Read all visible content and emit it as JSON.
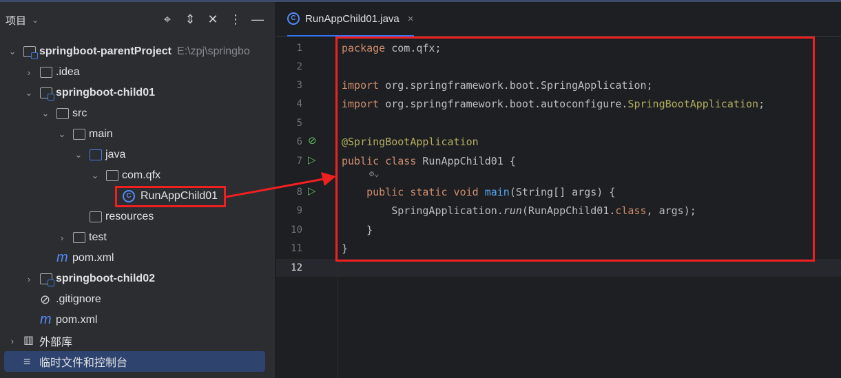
{
  "panel": {
    "title": "项目",
    "tools": [
      "locate-icon",
      "expand-icon",
      "collapse-icon",
      "more-icon",
      "minimize-icon"
    ]
  },
  "tree": [
    {
      "level": 0,
      "open": true,
      "icon": "module",
      "label": "springboot-parentProject",
      "bold": true,
      "path": "E:\\zpj\\springbo"
    },
    {
      "level": 1,
      "open": false,
      "icon": "folder",
      "label": ".idea"
    },
    {
      "level": 1,
      "open": true,
      "icon": "module",
      "label": "springboot-child01",
      "bold": true
    },
    {
      "level": 2,
      "open": true,
      "icon": "folder",
      "label": "src"
    },
    {
      "level": 3,
      "open": true,
      "icon": "folder",
      "label": "main"
    },
    {
      "level": 4,
      "open": true,
      "icon": "source",
      "label": "java"
    },
    {
      "level": 5,
      "open": true,
      "icon": "package",
      "label": "com.qfx"
    },
    {
      "level": 6,
      "icon": "class",
      "label": "RunAppChild01"
    },
    {
      "level": 4,
      "icon": "resources",
      "label": "resources"
    },
    {
      "level": 3,
      "open": false,
      "icon": "folder",
      "label": "test"
    },
    {
      "level": 2,
      "icon": "maven",
      "label": "pom.xml"
    },
    {
      "level": 1,
      "open": false,
      "icon": "module",
      "label": "springboot-child02",
      "bold": true
    },
    {
      "level": 1,
      "icon": "ignore",
      "label": ".gitignore"
    },
    {
      "level": 1,
      "icon": "maven",
      "label": "pom.xml"
    },
    {
      "level": 0,
      "open": false,
      "icon": "library",
      "label": "外部库"
    },
    {
      "level": 0,
      "icon": "scratch",
      "label": "临时文件和控制台",
      "selected": true
    }
  ],
  "tab": {
    "label": "RunAppChild01.java",
    "close": "×"
  },
  "colors": {
    "keyword": "#cf8e6d",
    "annotation": "#b3ae60",
    "method": "#56a8f5",
    "text": "#bcbec4",
    "highlight": "#f02020"
  },
  "code": [
    [
      [
        "package ",
        "kw"
      ],
      [
        "com.qfx;",
        ""
      ]
    ],
    [],
    [
      [
        "import ",
        "kw"
      ],
      [
        "org.springframework.boot.SpringApplication;",
        ""
      ]
    ],
    [
      [
        "import ",
        "kw"
      ],
      [
        "org.springframework.boot.autoconfigure.",
        ""
      ],
      [
        "SpringBootApplication",
        "an"
      ],
      [
        ";",
        ""
      ]
    ],
    [],
    [
      [
        "@SpringBootApplication",
        "an"
      ]
    ],
    [
      [
        "public class ",
        "kw"
      ],
      [
        "RunAppChild01 {",
        ""
      ]
    ],
    [
      [
        "    public static void ",
        "kw"
      ],
      [
        "main",
        "fn"
      ],
      [
        "(String[] args) {",
        ""
      ]
    ],
    [
      [
        "        SpringApplication.",
        ""
      ],
      [
        "run",
        "it"
      ],
      [
        "(RunAppChild01.",
        ""
      ],
      [
        "class",
        "kw"
      ],
      [
        ", args);",
        ""
      ]
    ],
    [
      [
        "    }",
        ""
      ]
    ],
    [
      [
        "}",
        ""
      ]
    ],
    []
  ]
}
